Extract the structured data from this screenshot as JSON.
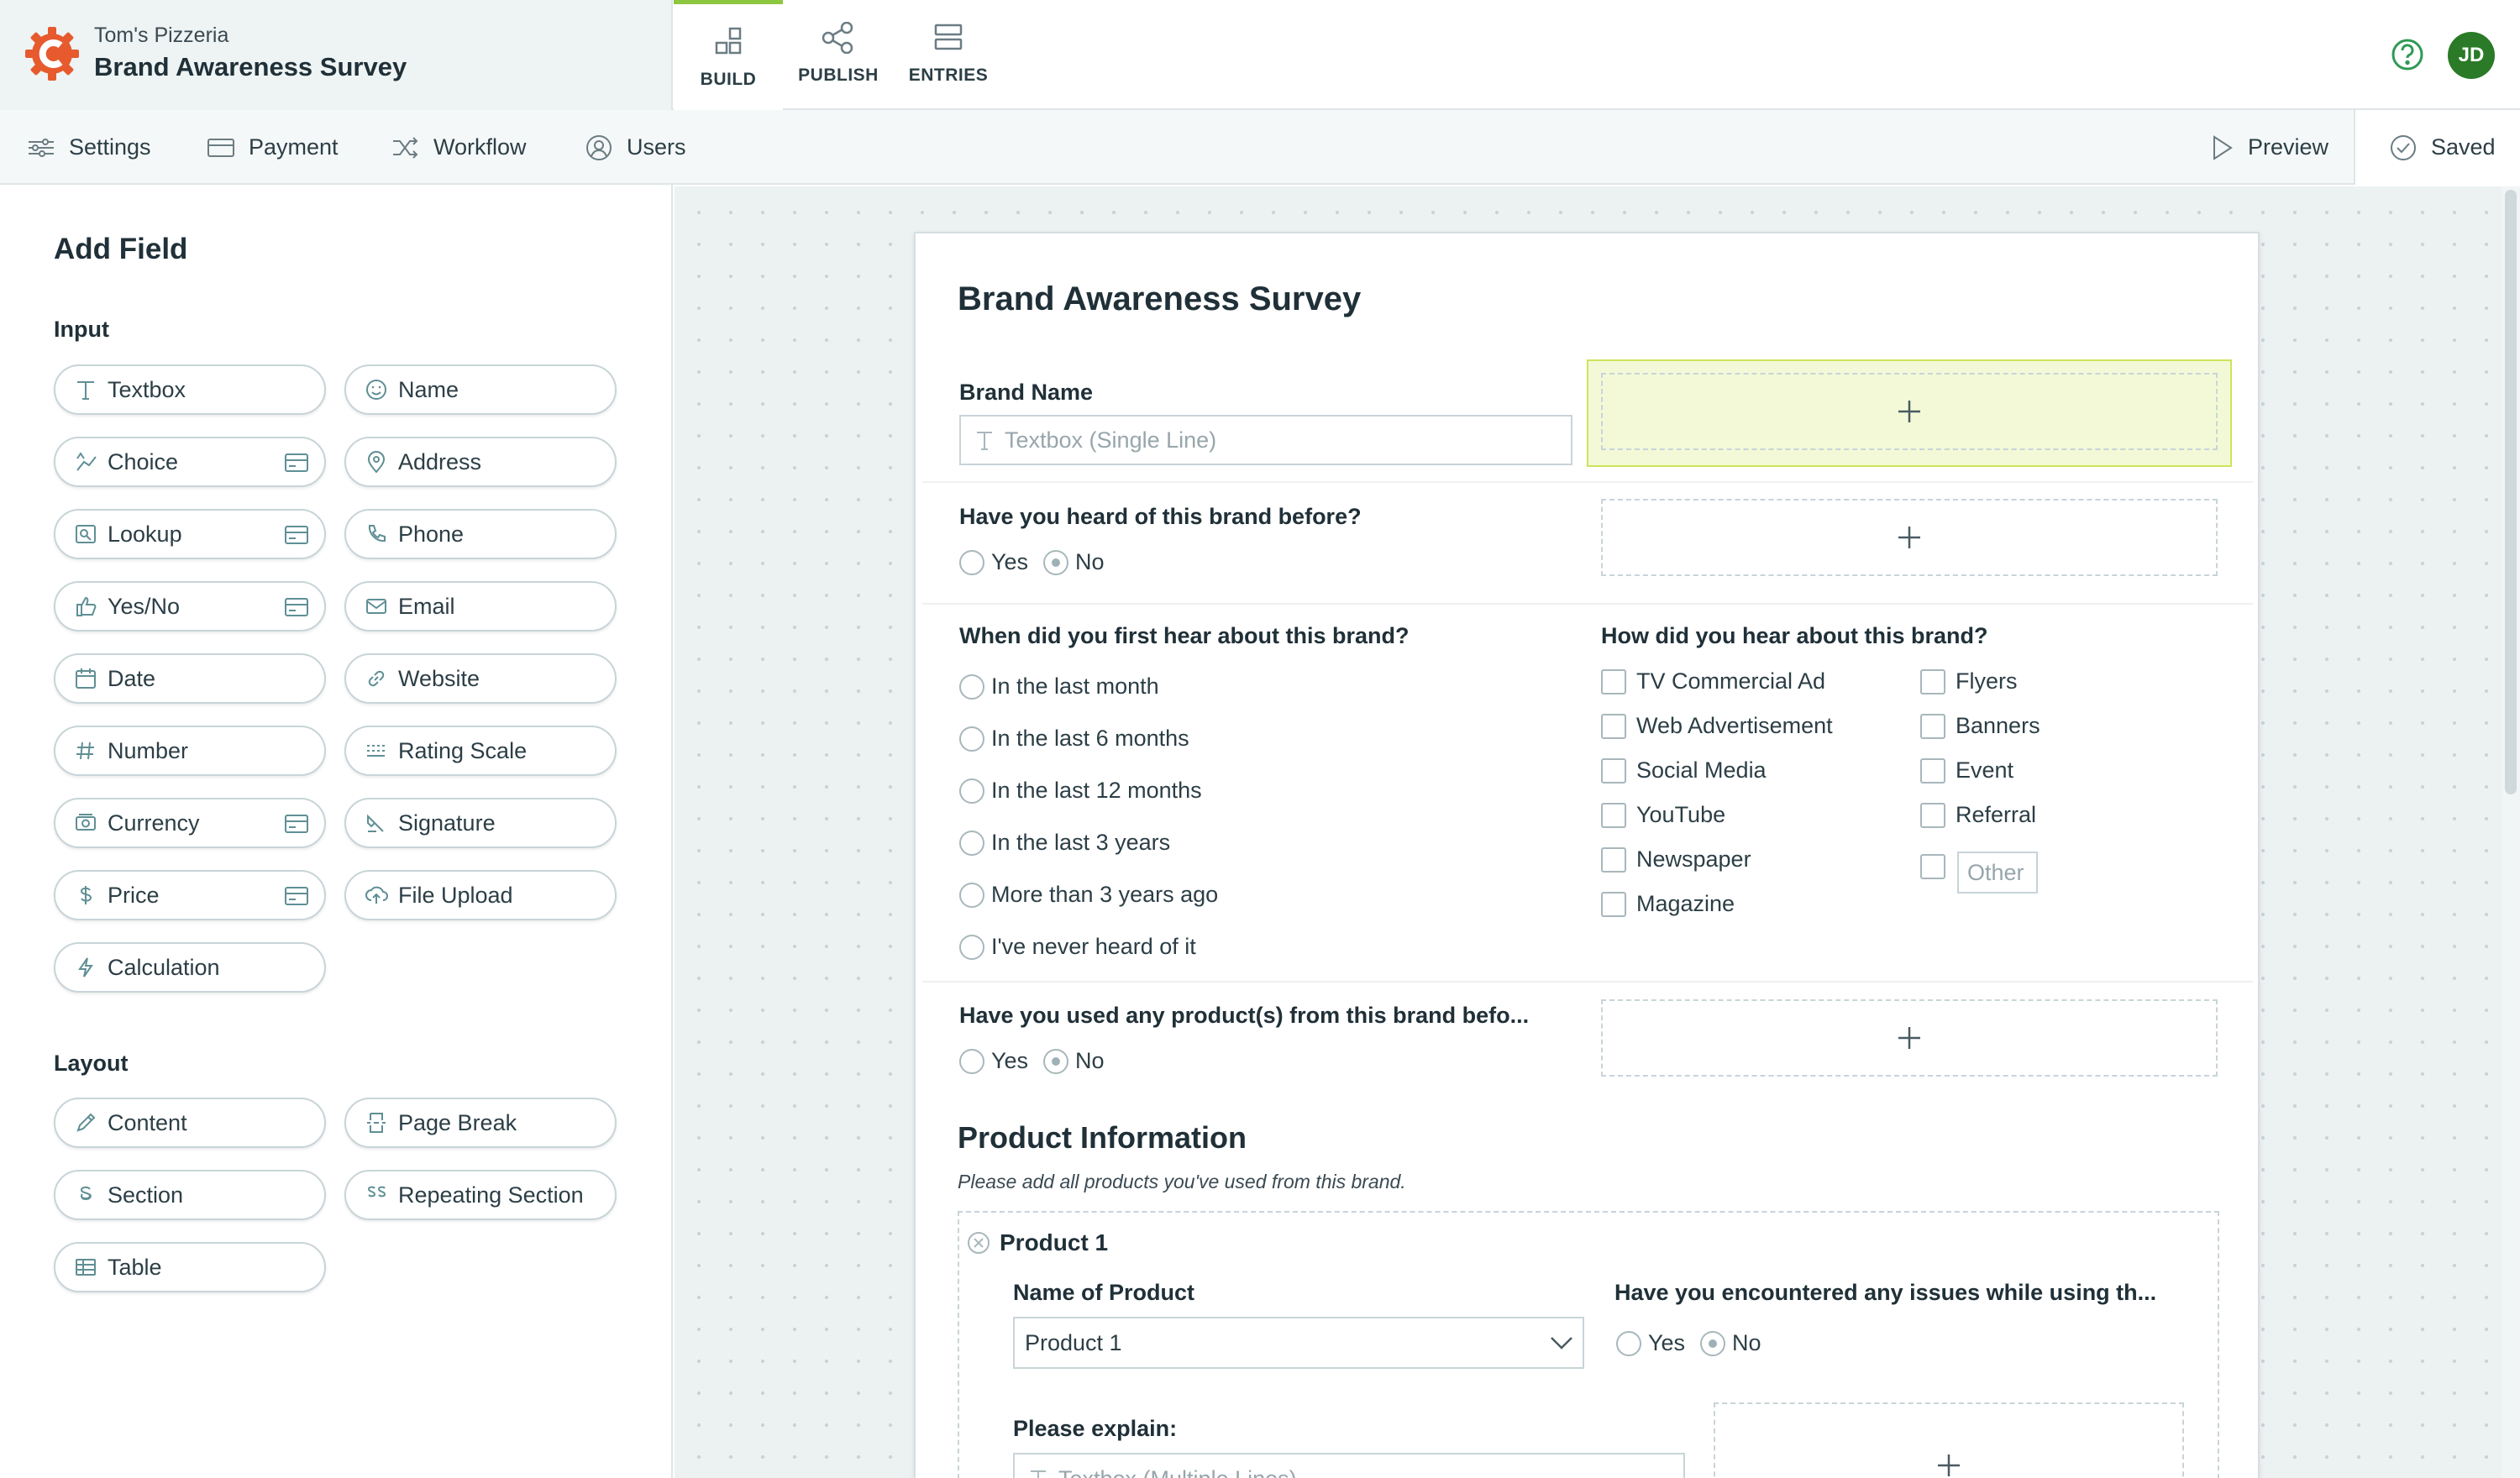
{
  "app": {
    "org_name": "Tom's Pizzeria",
    "form_name": "Brand Awareness Survey",
    "accent_color": "#8dc63f",
    "logo_color": "#e65a2e",
    "avatar_initials": "JD",
    "avatar_color": "#2a7a27"
  },
  "nav_tabs": [
    {
      "label": "BUILD",
      "icon": "build-icon",
      "active": true
    },
    {
      "label": "PUBLISH",
      "icon": "share-icon",
      "active": false
    },
    {
      "label": "ENTRIES",
      "icon": "entries-icon",
      "active": false
    }
  ],
  "subnav": {
    "items": [
      {
        "label": "Settings",
        "icon": "sliders-icon"
      },
      {
        "label": "Payment",
        "icon": "card-icon"
      },
      {
        "label": "Workflow",
        "icon": "shuffle-icon"
      },
      {
        "label": "Users",
        "icon": "user-icon"
      }
    ],
    "preview_label": "Preview",
    "saved_label": "Saved"
  },
  "sidebar": {
    "title": "Add Field",
    "input_title": "Input",
    "layout_title": "Layout",
    "input_fields": [
      {
        "label": "Textbox",
        "icon": "text-icon",
        "premium": false
      },
      {
        "label": "Name",
        "icon": "smiley-icon",
        "premium": false
      },
      {
        "label": "Choice",
        "icon": "choice-icon",
        "premium": true
      },
      {
        "label": "Address",
        "icon": "pin-icon",
        "premium": false
      },
      {
        "label": "Lookup",
        "icon": "lookup-icon",
        "premium": true
      },
      {
        "label": "Phone",
        "icon": "phone-icon",
        "premium": false
      },
      {
        "label": "Yes/No",
        "icon": "thumbs-up-icon",
        "premium": true
      },
      {
        "label": "Email",
        "icon": "mail-icon",
        "premium": false
      },
      {
        "label": "Date",
        "icon": "calendar-icon",
        "premium": false
      },
      {
        "label": "Website",
        "icon": "link-icon",
        "premium": false
      },
      {
        "label": "Number",
        "icon": "hash-icon",
        "premium": false
      },
      {
        "label": "Rating Scale",
        "icon": "rating-icon",
        "premium": false
      },
      {
        "label": "Currency",
        "icon": "currency-icon",
        "premium": true
      },
      {
        "label": "Signature",
        "icon": "signature-icon",
        "premium": false
      },
      {
        "label": "Price",
        "icon": "dollar-icon",
        "premium": true
      },
      {
        "label": "File Upload",
        "icon": "upload-icon",
        "premium": false
      },
      {
        "label": "Calculation",
        "icon": "bolt-icon",
        "premium": false
      }
    ],
    "layout_fields": [
      {
        "label": "Content",
        "icon": "pencil-icon"
      },
      {
        "label": "Page Break",
        "icon": "page-break-icon"
      },
      {
        "label": "Section",
        "icon": "section-icon"
      },
      {
        "label": "Repeating Section",
        "icon": "repeating-section-icon"
      },
      {
        "label": "Table",
        "icon": "table-icon"
      }
    ]
  },
  "form": {
    "title": "Brand Awareness Survey",
    "brand_name": {
      "label": "Brand Name",
      "placeholder": "Textbox (Single Line)"
    },
    "heard_before": {
      "label": "Have you heard of this brand before?",
      "options": [
        "Yes",
        "No"
      ],
      "selected": "No"
    },
    "first_hear": {
      "label": "When did you first hear about this brand?",
      "options": [
        "In the last month",
        "In the last 6 months",
        "In the last 12 months",
        "In the last 3 years",
        "More than 3 years ago",
        "I've never heard of it"
      ]
    },
    "how_hear": {
      "label": "How did you hear about this brand?",
      "col1": [
        "TV Commercial Ad",
        "Web Advertisement",
        "Social Media",
        "YouTube",
        "Newspaper",
        "Magazine"
      ],
      "col2": [
        "Flyers",
        "Banners",
        "Event",
        "Referral"
      ],
      "other_placeholder": "Other"
    },
    "used_products": {
      "label": "Have you used any product(s) from this brand befo...",
      "options": [
        "Yes",
        "No"
      ],
      "selected": "No"
    },
    "product_section": {
      "title": "Product Information",
      "description": "Please add all products you've used from this brand.",
      "item_title": "Product 1",
      "name_label": "Name of Product",
      "name_value": "Product 1",
      "issues_label": "Have you encountered any issues while using th...",
      "issues_options": [
        "Yes",
        "No"
      ],
      "issues_selected": "No",
      "explain_label": "Please explain:",
      "explain_placeholder": "Textbox (Multiple Lines)"
    }
  }
}
